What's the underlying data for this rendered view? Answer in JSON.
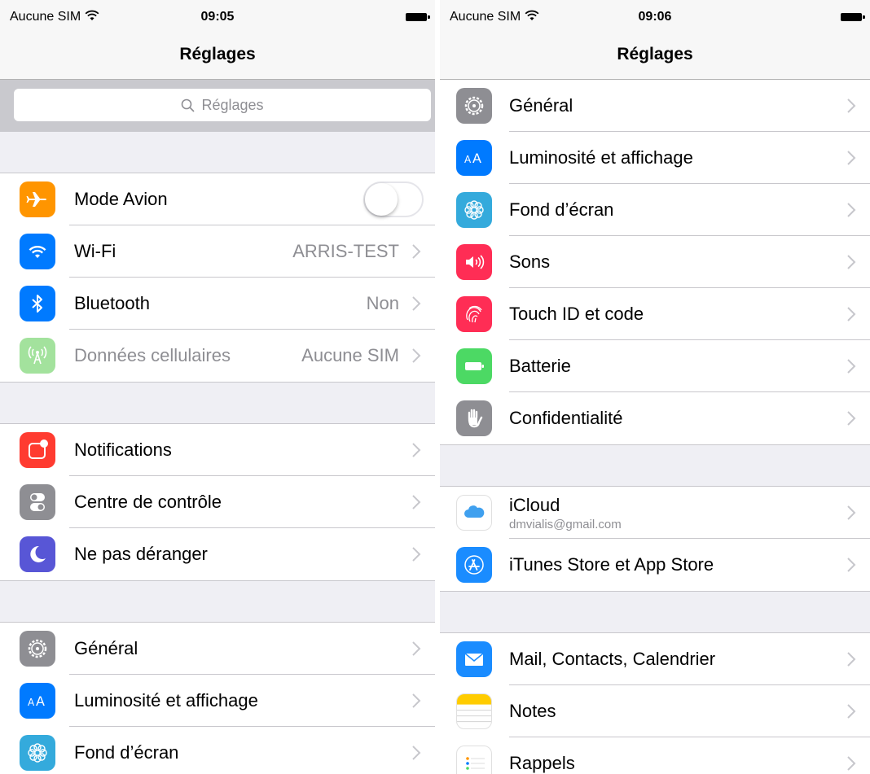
{
  "left": {
    "status": {
      "carrier": "Aucune SIM",
      "time": "09:05"
    },
    "nav_title": "Réglages",
    "search_placeholder": "Réglages",
    "groups": [
      [
        {
          "label": "Mode Avion",
          "icon": "airplane-icon",
          "color": "#ff9500",
          "toggle": "off"
        },
        {
          "label": "Wi-Fi",
          "value": "ARRIS-TEST",
          "icon": "wifi-icon",
          "color": "#007aff"
        },
        {
          "label": "Bluetooth",
          "value": "Non",
          "icon": "bluetooth-icon",
          "color": "#007aff"
        },
        {
          "label": "Données cellulaires",
          "value": "Aucune SIM",
          "icon": "cellular-antenna-icon",
          "color": "#a3e29d",
          "disabled": true
        }
      ],
      [
        {
          "label": "Notifications",
          "icon": "notifications-icon",
          "color": "#ff3b30"
        },
        {
          "label": "Centre de contrôle",
          "icon": "control-center-icon",
          "color": "#8e8e93"
        },
        {
          "label": "Ne pas déranger",
          "icon": "moon-icon",
          "color": "#5856d6"
        }
      ],
      [
        {
          "label": "Général",
          "icon": "gear-icon",
          "color": "#8e8e93"
        },
        {
          "label": "Luminosité et affichage",
          "icon": "text-size-icon",
          "color": "#007aff"
        },
        {
          "label": "Fond d’écran",
          "icon": "wallpaper-flower-icon",
          "color": "#34aadc"
        }
      ]
    ]
  },
  "right": {
    "status": {
      "carrier": "Aucune SIM",
      "time": "09:06"
    },
    "nav_title": "Réglages",
    "groups": [
      [
        {
          "label": "Général",
          "icon": "gear-icon",
          "color": "#8e8e93"
        },
        {
          "label": "Luminosité et affichage",
          "icon": "text-size-icon",
          "color": "#007aff"
        },
        {
          "label": "Fond d’écran",
          "icon": "wallpaper-flower-icon",
          "color": "#34aadc"
        },
        {
          "label": "Sons",
          "icon": "speaker-icon",
          "color": "#ff2d55"
        },
        {
          "label": "Touch ID et code",
          "icon": "fingerprint-icon",
          "color": "#ff2d55"
        },
        {
          "label": "Batterie",
          "icon": "battery-icon",
          "color": "#4cd964"
        },
        {
          "label": "Confidentialité",
          "icon": "hand-icon",
          "color": "#8e8e93"
        }
      ],
      [
        {
          "label": "iCloud",
          "sublabel": "dmvialis@gmail.com",
          "icon": "icloud-icon",
          "color": "#ffffff"
        },
        {
          "label": "iTunes Store et App Store",
          "icon": "app-store-icon",
          "color": "#1a8cff"
        }
      ],
      [
        {
          "label": "Mail, Contacts, Calendrier",
          "icon": "mail-icon",
          "color": "#1a8cff"
        },
        {
          "label": "Notes",
          "icon": "notes-icon",
          "color": "#ffcc00"
        },
        {
          "label": "Rappels",
          "icon": "reminders-icon",
          "color": "#ffffff"
        }
      ]
    ]
  }
}
